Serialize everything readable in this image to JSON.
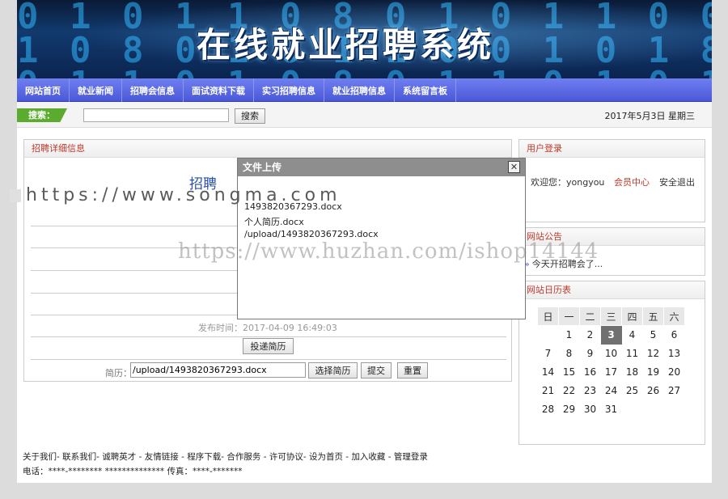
{
  "banner": {
    "title": "在线就业招聘系统"
  },
  "nav": {
    "items": [
      "网站首页",
      "就业新闻",
      "招聘会信息",
      "面试资料下载",
      "实习招聘信息",
      "就业招聘信息",
      "系统留言板"
    ]
  },
  "search": {
    "label": "搜索：",
    "button": "搜索",
    "value": ""
  },
  "date": "2017年5月3日 星期三",
  "detail": {
    "header": "招聘详细信息",
    "title": "招聘",
    "publish_label": "发布时间：",
    "publish_time": "2017-04-09 16:49:03",
    "submit_resume": "投递简历",
    "resume_label": "简历：",
    "resume_value": "/upload/1493820367293.docx",
    "choose_button": "选择简历",
    "submit_button": "提交",
    "reset_button": "重置"
  },
  "login": {
    "header": "用户登录",
    "welcome": "欢迎您：yongyou",
    "member_center": "会员中心",
    "logout": "安全退出"
  },
  "notice": {
    "header": "网站公告",
    "items": [
      "今天开招聘会了..."
    ]
  },
  "calendar": {
    "header": "网站日历表",
    "weekdays": [
      "日",
      "一",
      "二",
      "三",
      "四",
      "五",
      "六"
    ],
    "today": 3,
    "weeks": [
      [
        "",
        "1",
        "2",
        "3",
        "4",
        "5",
        "6"
      ],
      [
        "7",
        "8",
        "9",
        "10",
        "11",
        "12",
        "13"
      ],
      [
        "14",
        "15",
        "16",
        "17",
        "18",
        "19",
        "20"
      ],
      [
        "21",
        "22",
        "23",
        "24",
        "25",
        "26",
        "27"
      ],
      [
        "28",
        "29",
        "30",
        "31",
        "",
        "",
        ""
      ]
    ]
  },
  "modal": {
    "title": "文件上传",
    "close": "✕",
    "lines": [
      "1493820367293.docx",
      "个人简历.docx",
      "/upload/1493820367293.docx"
    ]
  },
  "footer": {
    "links": [
      "关于我们",
      "联系我们",
      "诚聘英才",
      "友情链接",
      "程序下载",
      "合作服务",
      "许可协议",
      "设为首页",
      "加入收藏",
      "管理登录"
    ],
    "contact": "电话：****-******** ************** 传真：****-*******"
  },
  "watermarks": {
    "songma": "https://www.songma.com",
    "huzhan": "https://www.huzhan.com/ishop14144"
  }
}
